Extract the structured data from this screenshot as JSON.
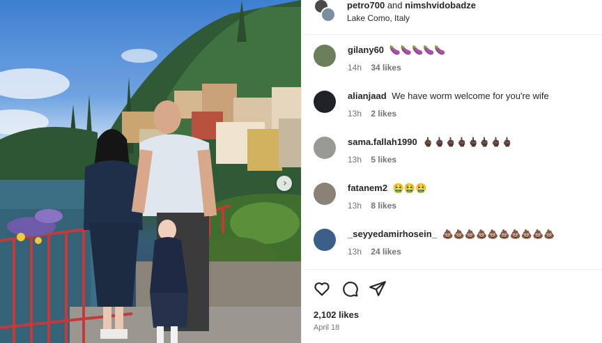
{
  "post": {
    "header_user_1": "petro700",
    "header_and": "and",
    "header_user_2": "nimshvidobadze",
    "location": "Lake Como, Italy"
  },
  "comments": [
    {
      "username": "gilany60",
      "text": "🍆🍆🍆🍆🍆",
      "time": "14h",
      "likes": "34 likes",
      "avatar_color": "#6d7f5a"
    },
    {
      "username": "alianjaad",
      "text": "We have worm welcome for you're wife",
      "time": "13h",
      "likes": "2 likes",
      "avatar_color": "#1e2226"
    },
    {
      "username": "sama.fallah1990",
      "text": "🖕🏿🖕🏿🖕🏿🖕🏿🖕🏿🖕🏿🖕🏿🖕🏿",
      "time": "13h",
      "likes": "5 likes",
      "avatar_color": "#9a9a95"
    },
    {
      "username": "fatanem2",
      "text": "🤮🤮🤮",
      "time": "13h",
      "likes": "8 likes",
      "avatar_color": "#8a8277"
    },
    {
      "username": "_seyyedamirhosein_",
      "text": "💩💩💩💩💩💩💩💩💩💩",
      "time": "13h",
      "likes": "24 likes",
      "avatar_color": "#3c5f8a"
    }
  ],
  "footer": {
    "likes": "2,102 likes",
    "date": "April 18"
  },
  "icons": {
    "like": "heart-icon",
    "comment": "comment-icon",
    "share": "send-icon",
    "carousel": "chevron-right-icon"
  }
}
